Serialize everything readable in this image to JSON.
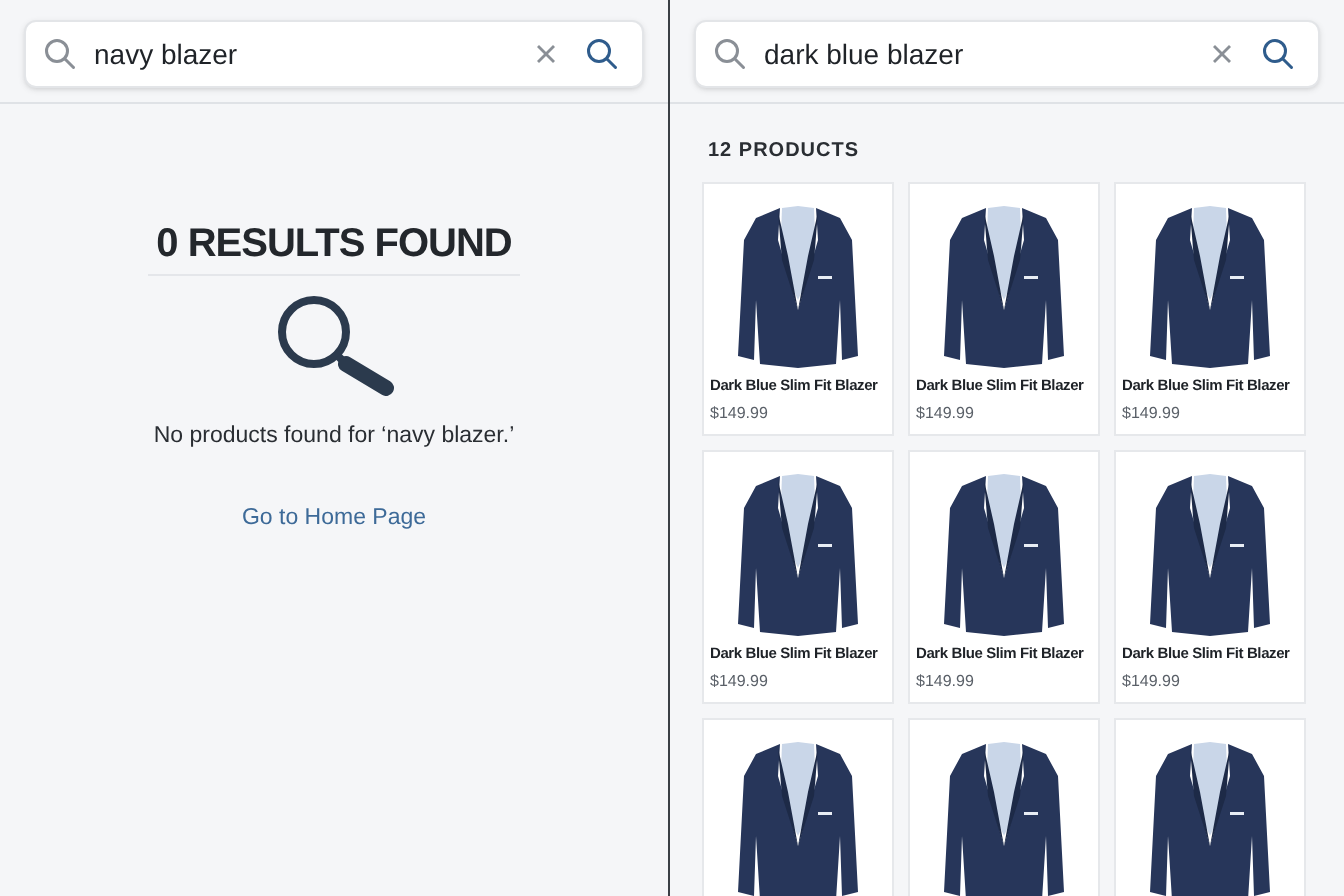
{
  "left_panel": {
    "search": {
      "value": "navy blazer"
    },
    "title": "0 RESULTS FOUND",
    "message": "No products found for ‘navy blazer.’",
    "link": "Go to Home Page"
  },
  "right_panel": {
    "search": {
      "value": "dark blue blazer"
    },
    "count": "12 PRODUCTS",
    "products": [
      {
        "kind": "card",
        "name": "Dark Blue Slim Fit Blazer",
        "price": "$149.99"
      },
      {
        "kind": "card",
        "name": "Dark Blue Slim Fit Blazer",
        "price": "$149.99"
      },
      {
        "kind": "card",
        "name": "Dark Blue Slim Fit Blazer",
        "price": "$149.99"
      },
      {
        "kind": "card",
        "name": "Dark Blue Slim Fit Blazer",
        "price": "$149.99"
      },
      {
        "kind": "card",
        "name": "Dark Blue Slim Fit Blazer",
        "price": "$149.99"
      },
      {
        "kind": "card",
        "name": "Dark Blue Slim Fit Blazer",
        "price": "$149.99"
      },
      {
        "kind": "cut"
      },
      {
        "kind": "cut"
      },
      {
        "kind": "cut"
      }
    ]
  }
}
